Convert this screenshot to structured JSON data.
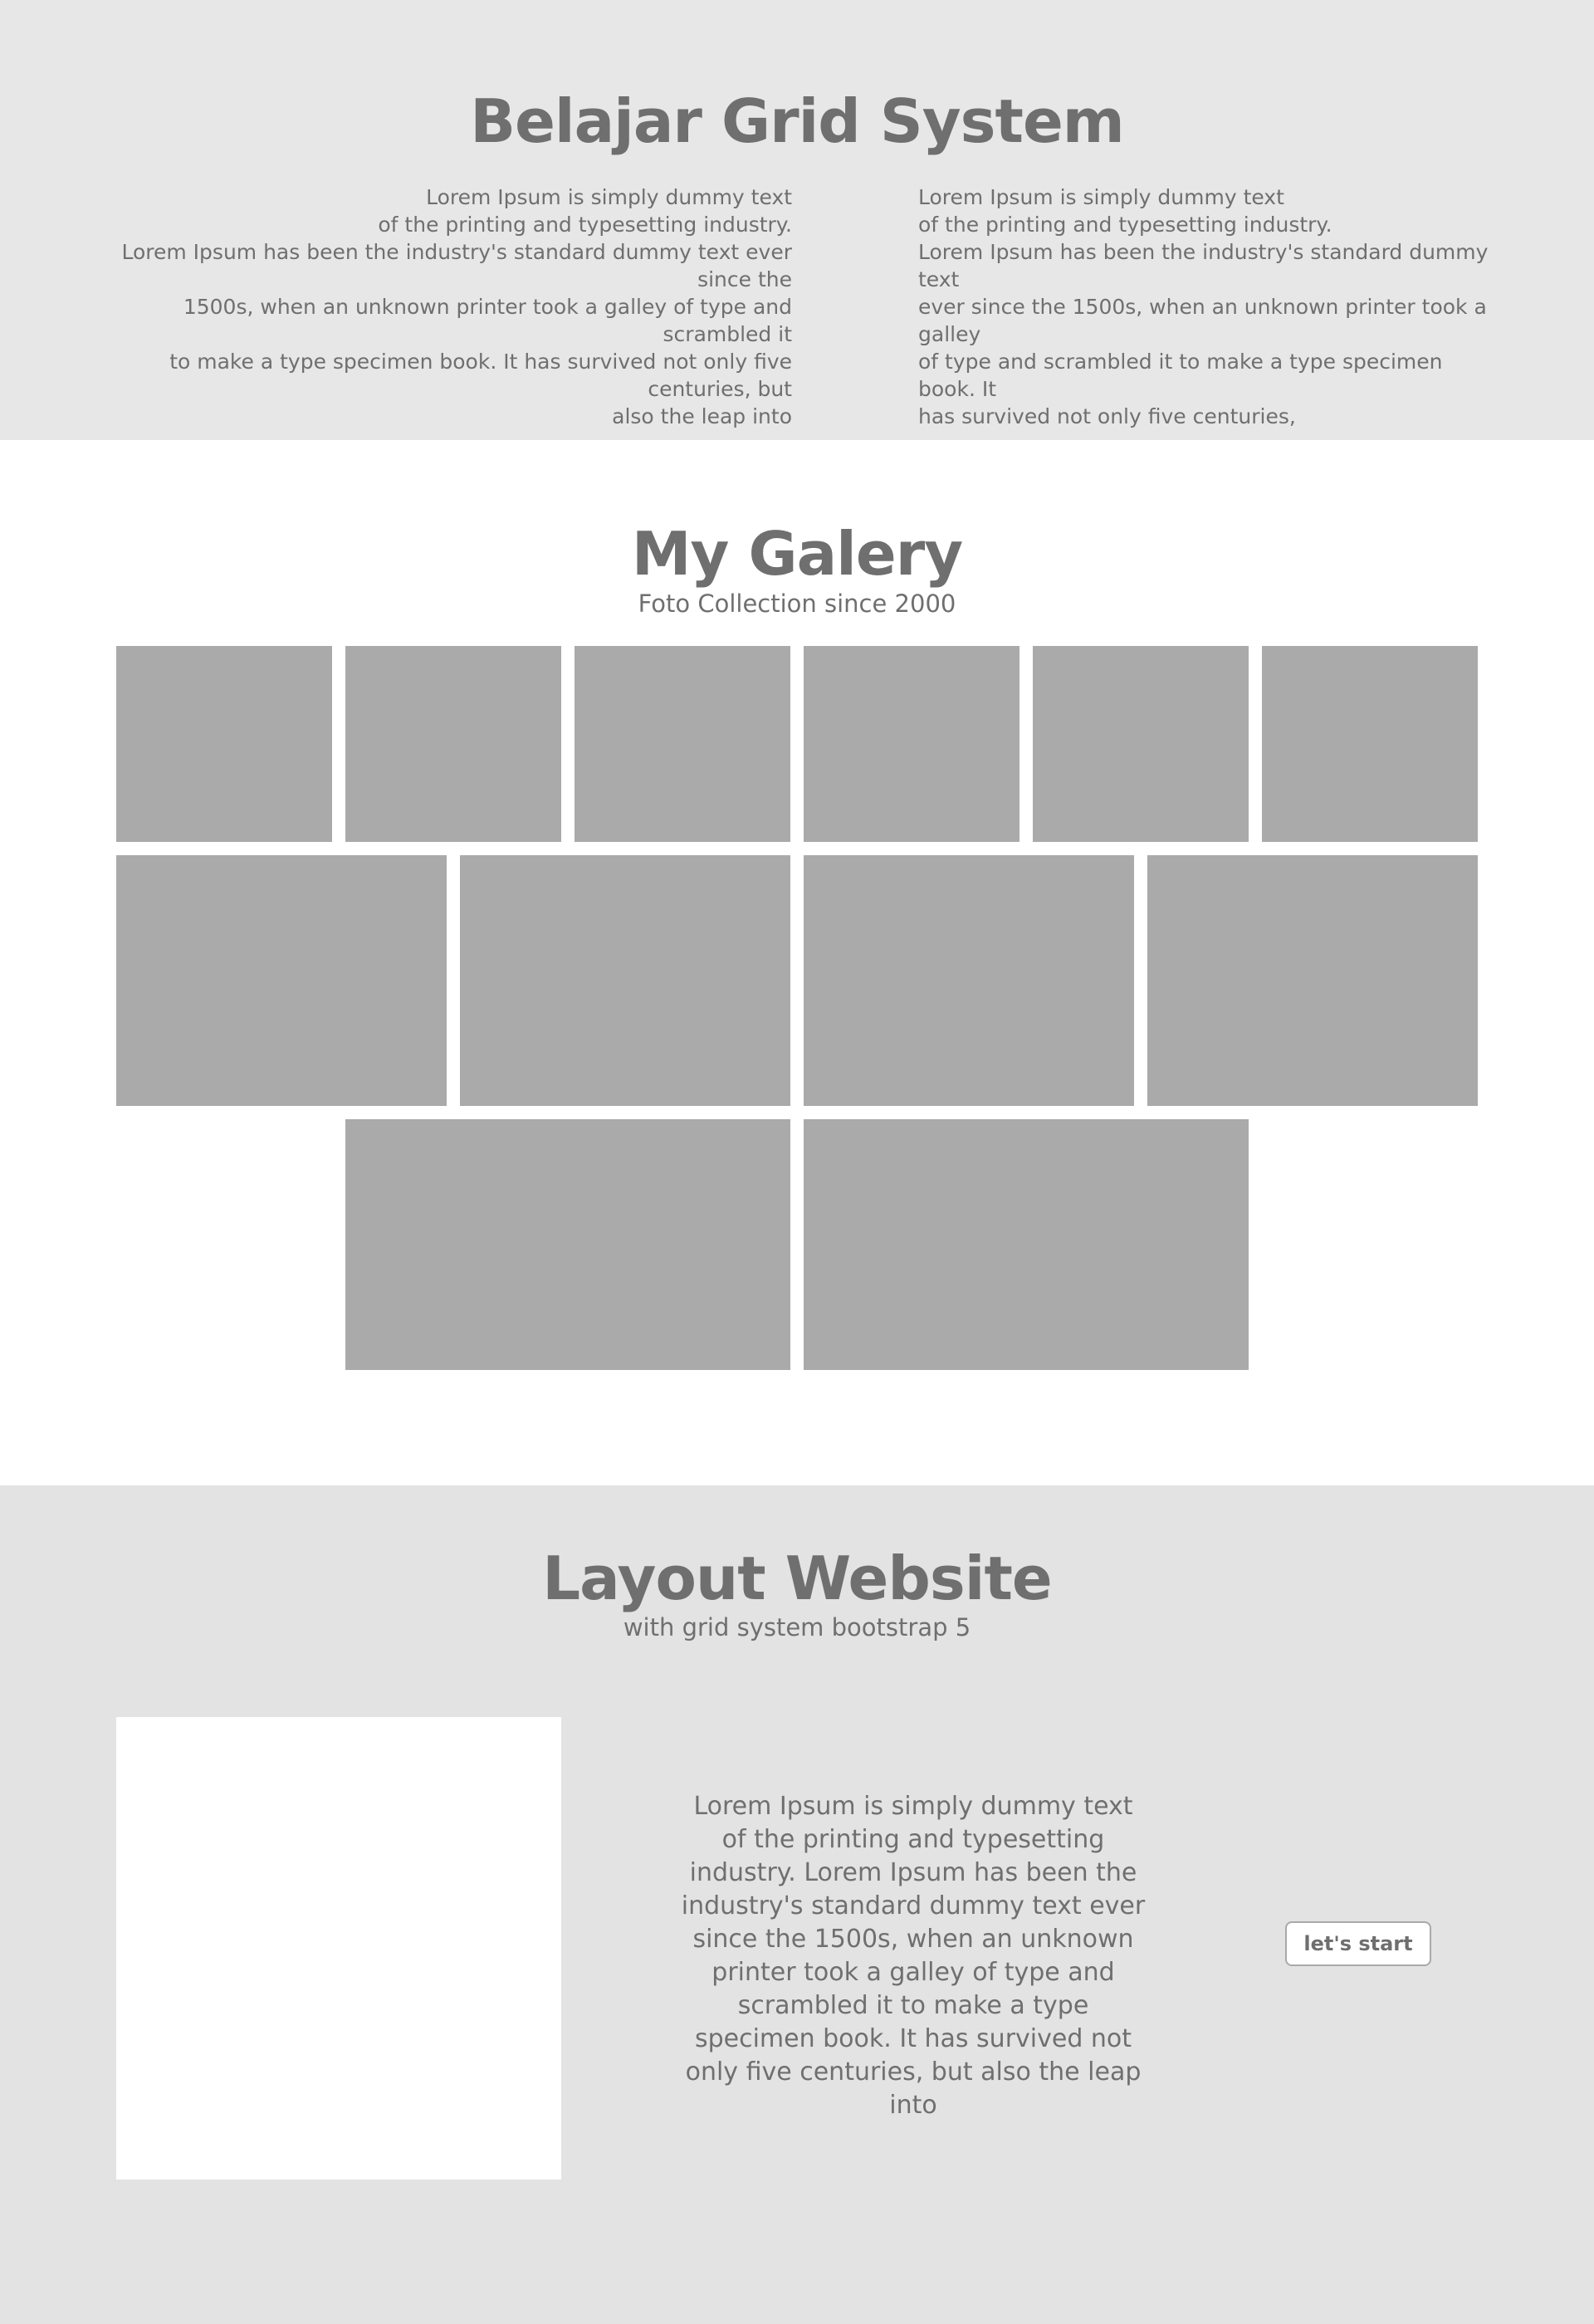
{
  "grid_section": {
    "title": "Belajar Grid System",
    "left_text": "Lorem Ipsum is simply dummy text\nof the printing and typesetting industry.\nLorem Ipsum has been the industry's standard dummy text ever since the\n1500s, when an unknown printer took a galley of type and scrambled it\nto make a type specimen book. It has survived not only five centuries, but\nalso the leap into",
    "right_text": "Lorem Ipsum is simply dummy text\nof the printing and typesetting industry.\nLorem Ipsum has been the industry's standard dummy text\never since the 1500s, when an unknown printer took a galley\nof type and scrambled it to make a type specimen book. It\nhas survived not only five centuries,"
  },
  "galery_section": {
    "title": "My Galery",
    "subtitle": "Foto Collection since 2000"
  },
  "layout_section": {
    "title": "Layout Website",
    "subtitle": "with grid system bootstrap 5",
    "body_text": "Lorem Ipsum is simply dummy text of the printing and typesetting industry. Lorem Ipsum has been the industry's standard dummy text ever since the 1500s, when an unknown printer took a galley of type and scrambled it to make a type specimen book. It has survived not only five centuries, but also the leap into",
    "button_label": "let's start"
  },
  "colors": {
    "text": "#6f6f6f",
    "section_gray": "#e7e7e7",
    "section_gray_2": "#e3e3e3",
    "placeholder": "#aaaaaa"
  }
}
